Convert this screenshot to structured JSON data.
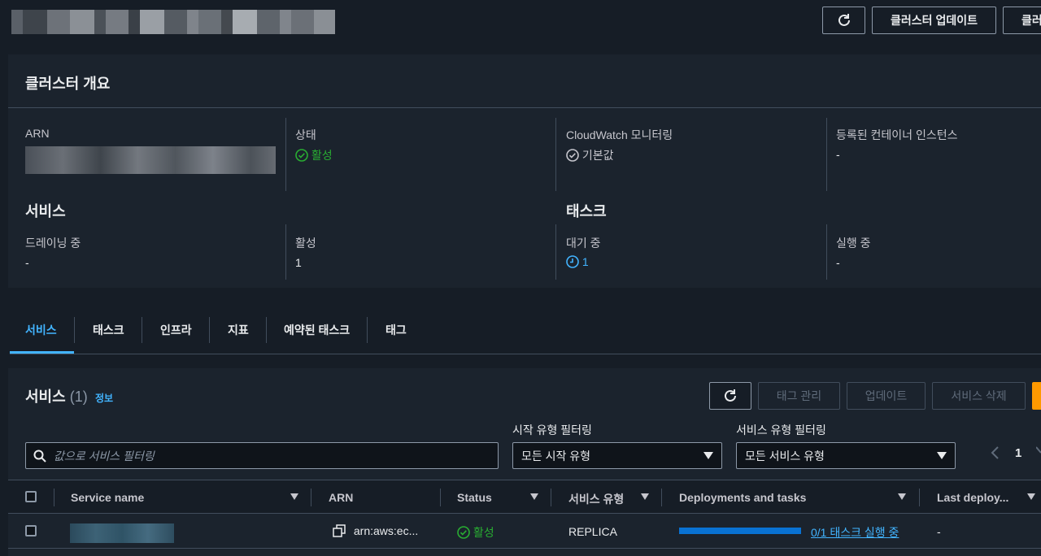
{
  "header": {
    "refresh_icon": "refresh-icon",
    "update_cluster_label": "클러스터 업데이트",
    "next_button_label": "클러"
  },
  "overview": {
    "title": "클러스터 개요",
    "arn_label": "ARN",
    "status_label": "상태",
    "status_value": "활성",
    "cloudwatch_label": "CloudWatch 모니터링",
    "cloudwatch_value": "기본값",
    "registered_label": "등록된 컨테이너 인스턴스",
    "registered_value": "-",
    "services_heading": "서비스",
    "draining_label": "드레이닝 중",
    "draining_value": "-",
    "active_label": "활성",
    "active_value": "1",
    "tasks_heading": "태스크",
    "pending_label": "대기 중",
    "pending_value": "1",
    "running_label": "실행 중",
    "running_value": "-"
  },
  "tabs": [
    "서비스",
    "태스크",
    "인프라",
    "지표",
    "예약된 태스크",
    "태그"
  ],
  "services": {
    "title": "서비스",
    "count": "(1)",
    "info_link": "정보",
    "manage_tags_label": "태그 관리",
    "update_label": "업데이트",
    "delete_label": "서비스 삭제",
    "launch_filter_label": "시작 유형 필터링",
    "launch_filter_value": "모든 시작 유형",
    "service_filter_label": "서비스 유형 필터링",
    "service_filter_value": "모든 서비스 유형",
    "search_placeholder": "값으로 서비스 필터링",
    "page_number": "1",
    "columns": [
      "Service name",
      "ARN",
      "Status",
      "서비스 유형",
      "Deployments and tasks",
      "Last deploy..."
    ],
    "rows": [
      {
        "arn": "arn:aws:ec...",
        "status": "활성",
        "type": "REPLICA",
        "deployment": "0/1 태스크 실행 중",
        "deployment_progress": 0,
        "last_deploy": "-"
      }
    ]
  },
  "colors": {
    "background": "#161d26",
    "panel": "#1b232d",
    "accent_blue": "#42b4ff",
    "status_green": "#29ad32",
    "primary_orange": "#ff9900",
    "progress_bar": "#0972d3"
  }
}
